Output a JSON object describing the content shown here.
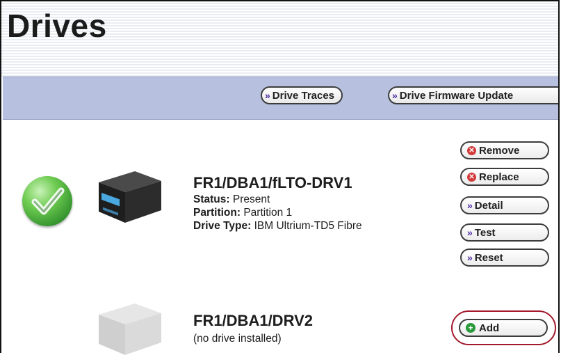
{
  "page": {
    "title": "Drives"
  },
  "toolbar": {
    "drive_traces": "Drive Traces",
    "drive_firmware_update": "Drive Firmware Update"
  },
  "drives": [
    {
      "name": "FR1/DBA1/fLTO-DRV1",
      "status_label": "Status:",
      "status": "Present",
      "partition_label": "Partition:",
      "partition": "Partition 1",
      "type_label": "Drive Type:",
      "type": "IBM Ultrium-TD5 Fibre",
      "actions": {
        "remove": "Remove",
        "replace": "Replace",
        "detail": "Detail",
        "test": "Test",
        "reset": "Reset"
      }
    },
    {
      "name": "FR1/DBA1/DRV2",
      "note": "(no drive installed)",
      "actions": {
        "add": "Add"
      }
    }
  ],
  "colors": {
    "toolbar_bg": "#b7c1df",
    "check_green": "#3ea73a",
    "highlight_ring": "#a4182b"
  },
  "icons": {
    "status": "checkmark-icon",
    "drive": "tape-drive-icon",
    "remove": "x-circle-icon",
    "add": "plus-circle-icon",
    "chevron": "double-chevron-icon"
  }
}
